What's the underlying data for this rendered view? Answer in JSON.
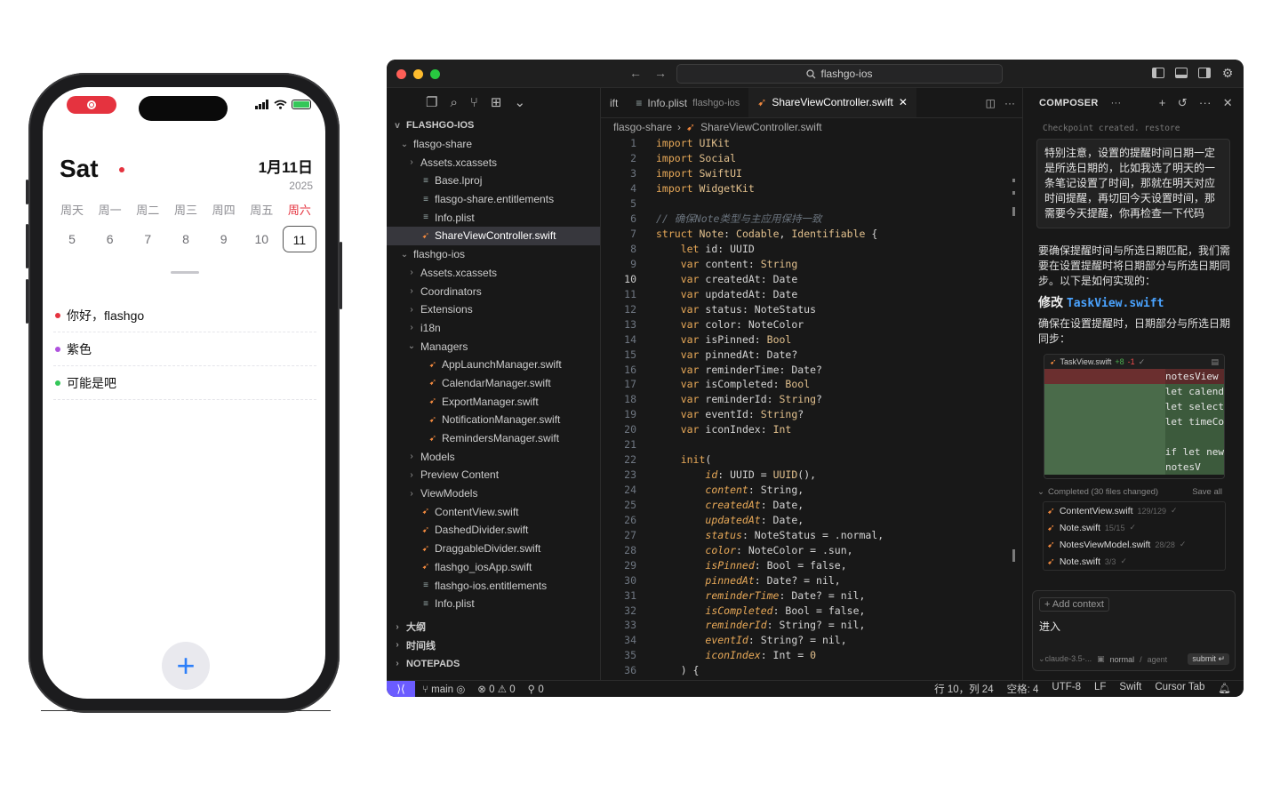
{
  "phone": {
    "day_name": "Sat",
    "date": "1月11日",
    "year": "2025",
    "weekdays": [
      "周天",
      "周一",
      "周二",
      "周三",
      "周四",
      "周五",
      "周六"
    ],
    "dates": [
      "5",
      "6",
      "7",
      "8",
      "9",
      "10",
      "11"
    ],
    "notes": [
      {
        "text": "你好，flashgo",
        "color": "#e5333f"
      },
      {
        "text": "紫色",
        "color": "#af52de"
      },
      {
        "text": "可能是吧",
        "color": "#34c759"
      }
    ],
    "fab_symbol": "+"
  },
  "ide": {
    "search": "flashgo-ios",
    "explorer": {
      "root": "FLASHGO-IOS",
      "rows": [
        {
          "depth": 1,
          "chev": "v",
          "icon": "",
          "label": "flasgo-share"
        },
        {
          "depth": 2,
          "chev": ">",
          "icon": "",
          "label": "Assets.xcassets"
        },
        {
          "depth": 2,
          "chev": "",
          "icon": "file",
          "label": "Base.lproj"
        },
        {
          "depth": 2,
          "chev": "",
          "icon": "file",
          "label": "flasgo-share.entitlements"
        },
        {
          "depth": 2,
          "chev": "",
          "icon": "file",
          "label": "Info.plist"
        },
        {
          "depth": 2,
          "chev": "",
          "icon": "swift",
          "label": "ShareViewController.swift",
          "selected": true
        },
        {
          "depth": 1,
          "chev": "v",
          "icon": "",
          "label": "flashgo-ios"
        },
        {
          "depth": 2,
          "chev": ">",
          "icon": "",
          "label": "Assets.xcassets"
        },
        {
          "depth": 2,
          "chev": ">",
          "icon": "",
          "label": "Coordinators"
        },
        {
          "depth": 2,
          "chev": ">",
          "icon": "",
          "label": "Extensions"
        },
        {
          "depth": 2,
          "chev": ">",
          "icon": "",
          "label": "i18n"
        },
        {
          "depth": 2,
          "chev": "v",
          "icon": "",
          "label": "Managers"
        },
        {
          "depth": 3,
          "chev": "",
          "icon": "swift",
          "label": "AppLaunchManager.swift"
        },
        {
          "depth": 3,
          "chev": "",
          "icon": "swift",
          "label": "CalendarManager.swift"
        },
        {
          "depth": 3,
          "chev": "",
          "icon": "swift",
          "label": "ExportManager.swift"
        },
        {
          "depth": 3,
          "chev": "",
          "icon": "swift",
          "label": "NotificationManager.swift"
        },
        {
          "depth": 3,
          "chev": "",
          "icon": "swift",
          "label": "RemindersManager.swift"
        },
        {
          "depth": 2,
          "chev": ">",
          "icon": "",
          "label": "Models"
        },
        {
          "depth": 2,
          "chev": ">",
          "icon": "",
          "label": "Preview Content"
        },
        {
          "depth": 2,
          "chev": ">",
          "icon": "",
          "label": "ViewModels"
        },
        {
          "depth": 2,
          "chev": "",
          "icon": "swift",
          "label": "ContentView.swift"
        },
        {
          "depth": 2,
          "chev": "",
          "icon": "swift",
          "label": "DashedDivider.swift"
        },
        {
          "depth": 2,
          "chev": "",
          "icon": "swift",
          "label": "DraggableDivider.swift"
        },
        {
          "depth": 2,
          "chev": "",
          "icon": "swift",
          "label": "flashgo_iosApp.swift"
        },
        {
          "depth": 2,
          "chev": "",
          "icon": "file",
          "label": "flashgo-ios.entitlements"
        },
        {
          "depth": 2,
          "chev": "",
          "icon": "file",
          "label": "Info.plist"
        }
      ],
      "bottom_sections": [
        "大纲",
        "时间线",
        "NOTEPADS"
      ]
    },
    "tabs": [
      {
        "label": "ift",
        "sub": "",
        "active": false
      },
      {
        "label": "Info.plist",
        "sub": "flashgo-ios",
        "active": false
      },
      {
        "label": "ShareViewController.swift",
        "sub": "",
        "active": true
      }
    ],
    "breadcrumb": [
      "flasgo-share",
      "ShareViewController.swift"
    ],
    "current_line": 10,
    "code": [
      [
        [
          "kw",
          "import "
        ],
        [
          "ty",
          "UIKit"
        ]
      ],
      [
        [
          "kw",
          "import "
        ],
        [
          "ty",
          "Social"
        ]
      ],
      [
        [
          "kw",
          "import "
        ],
        [
          "ty",
          "SwiftUI"
        ]
      ],
      [
        [
          "kw",
          "import "
        ],
        [
          "ty",
          "WidgetKit"
        ]
      ],
      [],
      [
        [
          "cm",
          "// 确保Note类型与主应用保持一致"
        ]
      ],
      [
        [
          "kw",
          "struct "
        ],
        [
          "ty",
          "Note"
        ],
        [
          "tx",
          ": "
        ],
        [
          "ty",
          "Codable"
        ],
        [
          "tx",
          ", "
        ],
        [
          "ty",
          "Identifiable"
        ],
        [
          "tx",
          " {"
        ]
      ],
      [
        [
          "tx",
          "    "
        ],
        [
          "kw",
          "let "
        ],
        [
          "tx",
          "id: UUID"
        ]
      ],
      [
        [
          "tx",
          "    "
        ],
        [
          "kw",
          "var "
        ],
        [
          "tx",
          "content: "
        ],
        [
          "ty",
          "String"
        ]
      ],
      [
        [
          "tx",
          "    "
        ],
        [
          "kw",
          "var "
        ],
        [
          "tx",
          "createdAt: Date"
        ]
      ],
      [
        [
          "tx",
          "    "
        ],
        [
          "kw",
          "var "
        ],
        [
          "tx",
          "updatedAt: Date"
        ]
      ],
      [
        [
          "tx",
          "    "
        ],
        [
          "kw",
          "var "
        ],
        [
          "tx",
          "status: NoteStatus"
        ]
      ],
      [
        [
          "tx",
          "    "
        ],
        [
          "kw",
          "var "
        ],
        [
          "tx",
          "color: NoteColor"
        ]
      ],
      [
        [
          "tx",
          "    "
        ],
        [
          "kw",
          "var "
        ],
        [
          "tx",
          "isPinned: "
        ],
        [
          "ty",
          "Bool"
        ]
      ],
      [
        [
          "tx",
          "    "
        ],
        [
          "kw",
          "var "
        ],
        [
          "tx",
          "pinnedAt: Date?"
        ]
      ],
      [
        [
          "tx",
          "    "
        ],
        [
          "kw",
          "var "
        ],
        [
          "tx",
          "reminderTime: Date?"
        ]
      ],
      [
        [
          "tx",
          "    "
        ],
        [
          "kw",
          "var "
        ],
        [
          "tx",
          "isCompleted: "
        ],
        [
          "ty",
          "Bool"
        ]
      ],
      [
        [
          "tx",
          "    "
        ],
        [
          "kw",
          "var "
        ],
        [
          "tx",
          "reminderId: "
        ],
        [
          "ty",
          "String"
        ],
        [
          "tx",
          "?"
        ]
      ],
      [
        [
          "tx",
          "    "
        ],
        [
          "kw",
          "var "
        ],
        [
          "tx",
          "eventId: "
        ],
        [
          "ty",
          "String"
        ],
        [
          "tx",
          "?"
        ]
      ],
      [
        [
          "tx",
          "    "
        ],
        [
          "kw",
          "var "
        ],
        [
          "tx",
          "iconIndex: "
        ],
        [
          "ty",
          "Int"
        ]
      ],
      [],
      [
        [
          "tx",
          "    "
        ],
        [
          "kw",
          "init"
        ],
        [
          "tx",
          "("
        ]
      ],
      [
        [
          "tx",
          "        "
        ],
        [
          "prm",
          "id"
        ],
        [
          "tx",
          ": UUID = "
        ],
        [
          "ty",
          "UUID"
        ],
        [
          "tx",
          "(),"
        ]
      ],
      [
        [
          "tx",
          "        "
        ],
        [
          "prm",
          "content"
        ],
        [
          "tx",
          ": String,"
        ]
      ],
      [
        [
          "tx",
          "        "
        ],
        [
          "prm",
          "createdAt"
        ],
        [
          "tx",
          ": Date,"
        ]
      ],
      [
        [
          "tx",
          "        "
        ],
        [
          "prm",
          "updatedAt"
        ],
        [
          "tx",
          ": Date,"
        ]
      ],
      [
        [
          "tx",
          "        "
        ],
        [
          "prm",
          "status"
        ],
        [
          "tx",
          ": NoteStatus = .normal,"
        ]
      ],
      [
        [
          "tx",
          "        "
        ],
        [
          "prm",
          "color"
        ],
        [
          "tx",
          ": NoteColor = .sun,"
        ]
      ],
      [
        [
          "tx",
          "        "
        ],
        [
          "prm",
          "isPinned"
        ],
        [
          "tx",
          ": Bool = false,"
        ]
      ],
      [
        [
          "tx",
          "        "
        ],
        [
          "prm",
          "pinnedAt"
        ],
        [
          "tx",
          ": Date? = nil,"
        ]
      ],
      [
        [
          "tx",
          "        "
        ],
        [
          "prm",
          "reminderTime"
        ],
        [
          "tx",
          ": Date? = nil,"
        ]
      ],
      [
        [
          "tx",
          "        "
        ],
        [
          "prm",
          "isCompleted"
        ],
        [
          "tx",
          ": Bool = false,"
        ]
      ],
      [
        [
          "tx",
          "        "
        ],
        [
          "prm",
          "reminderId"
        ],
        [
          "tx",
          ": String? = nil,"
        ]
      ],
      [
        [
          "tx",
          "        "
        ],
        [
          "prm",
          "eventId"
        ],
        [
          "tx",
          ": String? = nil,"
        ]
      ],
      [
        [
          "tx",
          "        "
        ],
        [
          "prm",
          "iconIndex"
        ],
        [
          "tx",
          ": Int = "
        ],
        [
          "ty",
          "0"
        ]
      ],
      [
        [
          "tx",
          "    ) {"
        ]
      ]
    ],
    "composer": {
      "title": "COMPOSER",
      "checkpoint": "Checkpoint created. restore",
      "user_message": "特别注意，设置的提醒时间日期一定是所选日期的，比如我选了明天的一条笔记设置了时间，那就在明天对应时间提醒，再切回今天设置时间，那需要今天提醒，你再检查一下代码",
      "reply_intro": "要确保提醒时间与所选日期匹配，我们需要在设置提醒时将日期部分与所选日期同步。以下是如何实现的：",
      "edit_prefix": "修改",
      "edit_file": "TaskView.swift",
      "edit_desc": "确保在设置提醒时，日期部分与所选日期同步：",
      "diff": {
        "file": "TaskView.swift",
        "added": "+8",
        "removed": "-1",
        "lines": [
          "notesView",
          "let calend",
          "let select",
          "let timeCo",
          "",
          "if let new",
          "notesV"
        ]
      },
      "completed": "Completed (30 files changed)",
      "save_all": "Save all",
      "files": [
        {
          "name": "ContentView.swift",
          "count": "129/129"
        },
        {
          "name": "Note.swift",
          "count": "15/15"
        },
        {
          "name": "NotesViewModel.swift",
          "count": "28/28"
        },
        {
          "name": "Note.swift",
          "count": "3/3"
        }
      ],
      "add_context": "+ Add context",
      "input_value": "进入",
      "model": "claude-3.5-...",
      "mode": "normal",
      "agent": "agent",
      "submit": "submit"
    },
    "status": {
      "branch": "main",
      "errors": "0",
      "warnings": "0",
      "ports": "0",
      "position": "行 10，列 24",
      "spaces": "空格: 4",
      "encoding": "UTF-8",
      "eol": "LF",
      "language": "Swift",
      "keymap": "Cursor Tab"
    }
  }
}
